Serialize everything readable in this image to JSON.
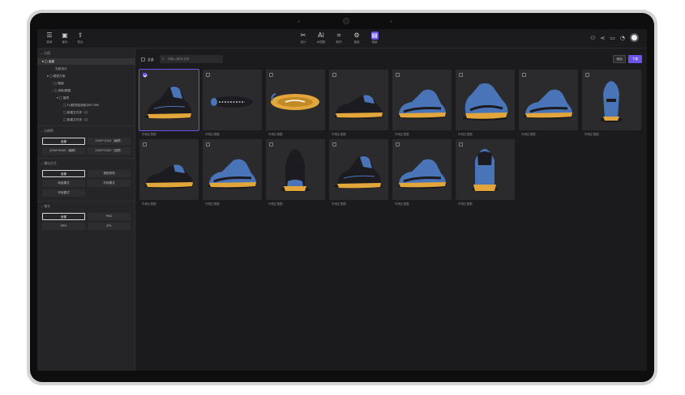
{
  "toolbar": {
    "left": [
      {
        "label": "菜单",
        "icon": "menu-icon"
      },
      {
        "label": "保存",
        "icon": "save-icon"
      },
      {
        "label": "导出",
        "icon": "export-icon"
      }
    ],
    "center": [
      {
        "label": "设计",
        "icon": "design-icon"
      },
      {
        "label": "AI搭配",
        "icon": "ai-icon",
        "glyph": "Ai"
      },
      {
        "label": "制作",
        "icon": "make-icon"
      },
      {
        "label": "渲染",
        "icon": "render-icon"
      },
      {
        "label": "相册",
        "icon": "album-icon"
      }
    ],
    "active_index": 4
  },
  "sidebar": {
    "classify_header": "分组",
    "tree": [
      {
        "label": "全部",
        "level": 0
      },
      {
        "label": "当前设计",
        "level": 1
      },
      {
        "label": "鞋类方案",
        "level": 1
      },
      {
        "label": "鞋面",
        "level": 2
      },
      {
        "label": "训练/跑鞋",
        "level": 2
      },
      {
        "label": "篮球",
        "level": 3
      },
      {
        "label": "FLJ鞋导篮测批次87786",
        "level": 4
      },
      {
        "label": "新建文件夹（1）",
        "level": 4
      },
      {
        "label": "新建文件夹（2）",
        "level": 4
      }
    ],
    "resolution_header": "分辨率",
    "resolutions": [
      "全部",
      "1920*1024（横屏）",
      "4000*4000（横屏）",
      "1920*1920（竖屏）"
    ],
    "mode_header": "输出方式",
    "modes": [
      "全部",
      "视频视角",
      "转盘模式",
      "环绕模式",
      "环绕模式"
    ],
    "format_header": "格式",
    "formats": [
      "全部",
      "PNG",
      "MP4",
      "JPG"
    ]
  },
  "main": {
    "select_all": "全选",
    "search_placeholder": "请输入编号/名称",
    "share_label": "添加",
    "download_label": "下载",
    "card_caption": "外侧正视图",
    "cards": [
      {
        "view": "side-high",
        "selected": true
      },
      {
        "view": "top"
      },
      {
        "view": "bottom"
      },
      {
        "view": "side-low"
      },
      {
        "view": "side-blue"
      },
      {
        "view": "three-quarter"
      },
      {
        "view": "side-blue"
      },
      {
        "view": "rear"
      },
      {
        "view": "side-low"
      },
      {
        "view": "side-blue"
      },
      {
        "view": "front"
      },
      {
        "view": "side-high"
      },
      {
        "view": "side-blue"
      },
      {
        "view": "heel"
      }
    ]
  },
  "colors": {
    "accent": "#6b52e8",
    "shoe_blue": "#4a74b8",
    "shoe_black": "#1c1c20",
    "sole_yellow": "#e2a63a"
  }
}
